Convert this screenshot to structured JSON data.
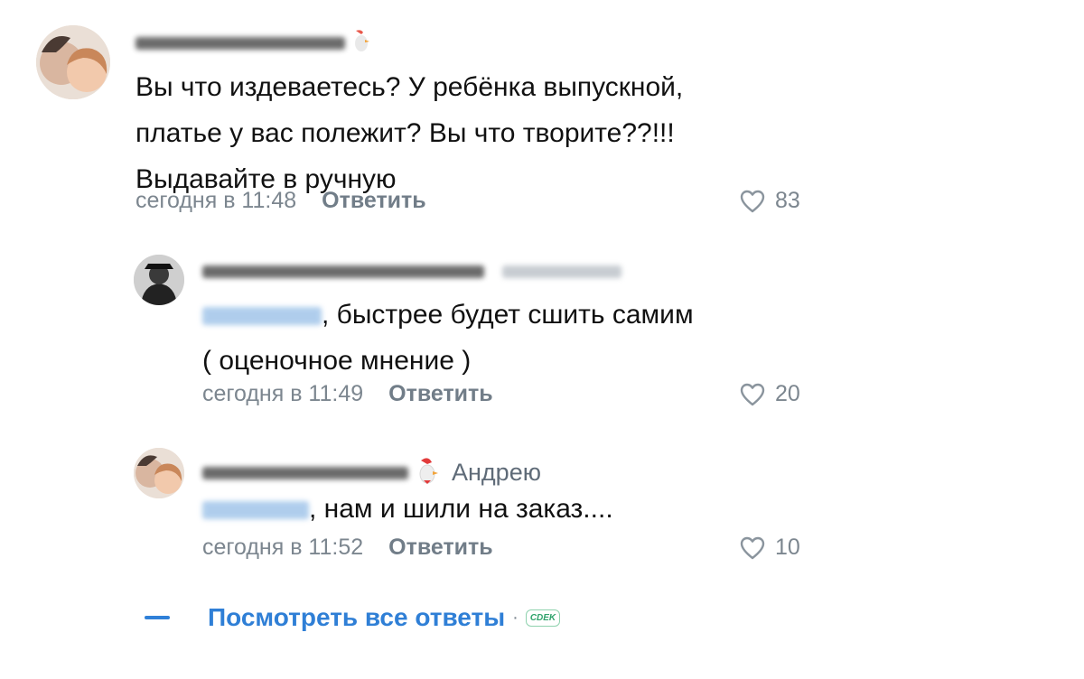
{
  "comments": [
    {
      "text_lines": [
        "Вы что издеваетесь? У ребёнка выпускной,",
        "платье у вас полежит? Вы что творите??!!!",
        "Выдавайте в ручную"
      ],
      "time": "сегодня в 11:48",
      "reply_label": "Ответить",
      "likes": "83"
    },
    {
      "mention_suffix": ", быстрее будет сшить самим",
      "text_line2": "( оценочное мнение )",
      "time": "сегодня в 11:49",
      "reply_label": "Ответить",
      "likes": "20"
    },
    {
      "reply_to": "Андрею",
      "mention_suffix": ", нам и шили на заказ....",
      "time": "сегодня в 11:52",
      "reply_label": "Ответить",
      "likes": "10"
    }
  ],
  "view_all": {
    "label": "Посмотреть все ответы",
    "separator": "·",
    "watermark": "CDEK"
  },
  "colors": {
    "link": "#2f7fd6",
    "meta": "#7c868f",
    "text": "#111111"
  }
}
